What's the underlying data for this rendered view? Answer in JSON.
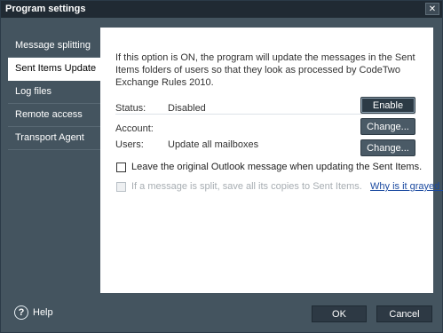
{
  "window": {
    "title": "Program settings",
    "close_glyph": "✕"
  },
  "sidebar": {
    "items": [
      {
        "label": "Message splitting",
        "active": false
      },
      {
        "label": "Sent Items Update",
        "active": true
      },
      {
        "label": "Log files",
        "active": false
      },
      {
        "label": "Remote access",
        "active": false
      },
      {
        "label": "Transport Agent",
        "active": false
      }
    ]
  },
  "content": {
    "description": "If this option is ON, the program will update the messages in the Sent Items folders of users so that they look as processed by CodeTwo Exchange Rules 2010.",
    "status": {
      "label": "Status:",
      "value": "Disabled",
      "button": "Enable"
    },
    "account": {
      "label": "Account:",
      "value": "",
      "button": "Change..."
    },
    "users": {
      "label": "Users:",
      "value": "Update all mailboxes",
      "button": "Change..."
    },
    "leave_original": {
      "label": "Leave the original Outlook message when updating the Sent Items.",
      "checked": false
    },
    "split_copies": {
      "label": "If a message is split, save all its copies to Sent Items.",
      "checked": false,
      "disabled": true,
      "link": "Why is it grayed out?"
    }
  },
  "footer": {
    "help_label": "Help",
    "help_glyph": "?",
    "ok": "OK",
    "cancel": "Cancel"
  },
  "colors": {
    "window_bg": "#44545f",
    "titlebar_bg": "#202a33",
    "link": "#1b4aa0"
  }
}
